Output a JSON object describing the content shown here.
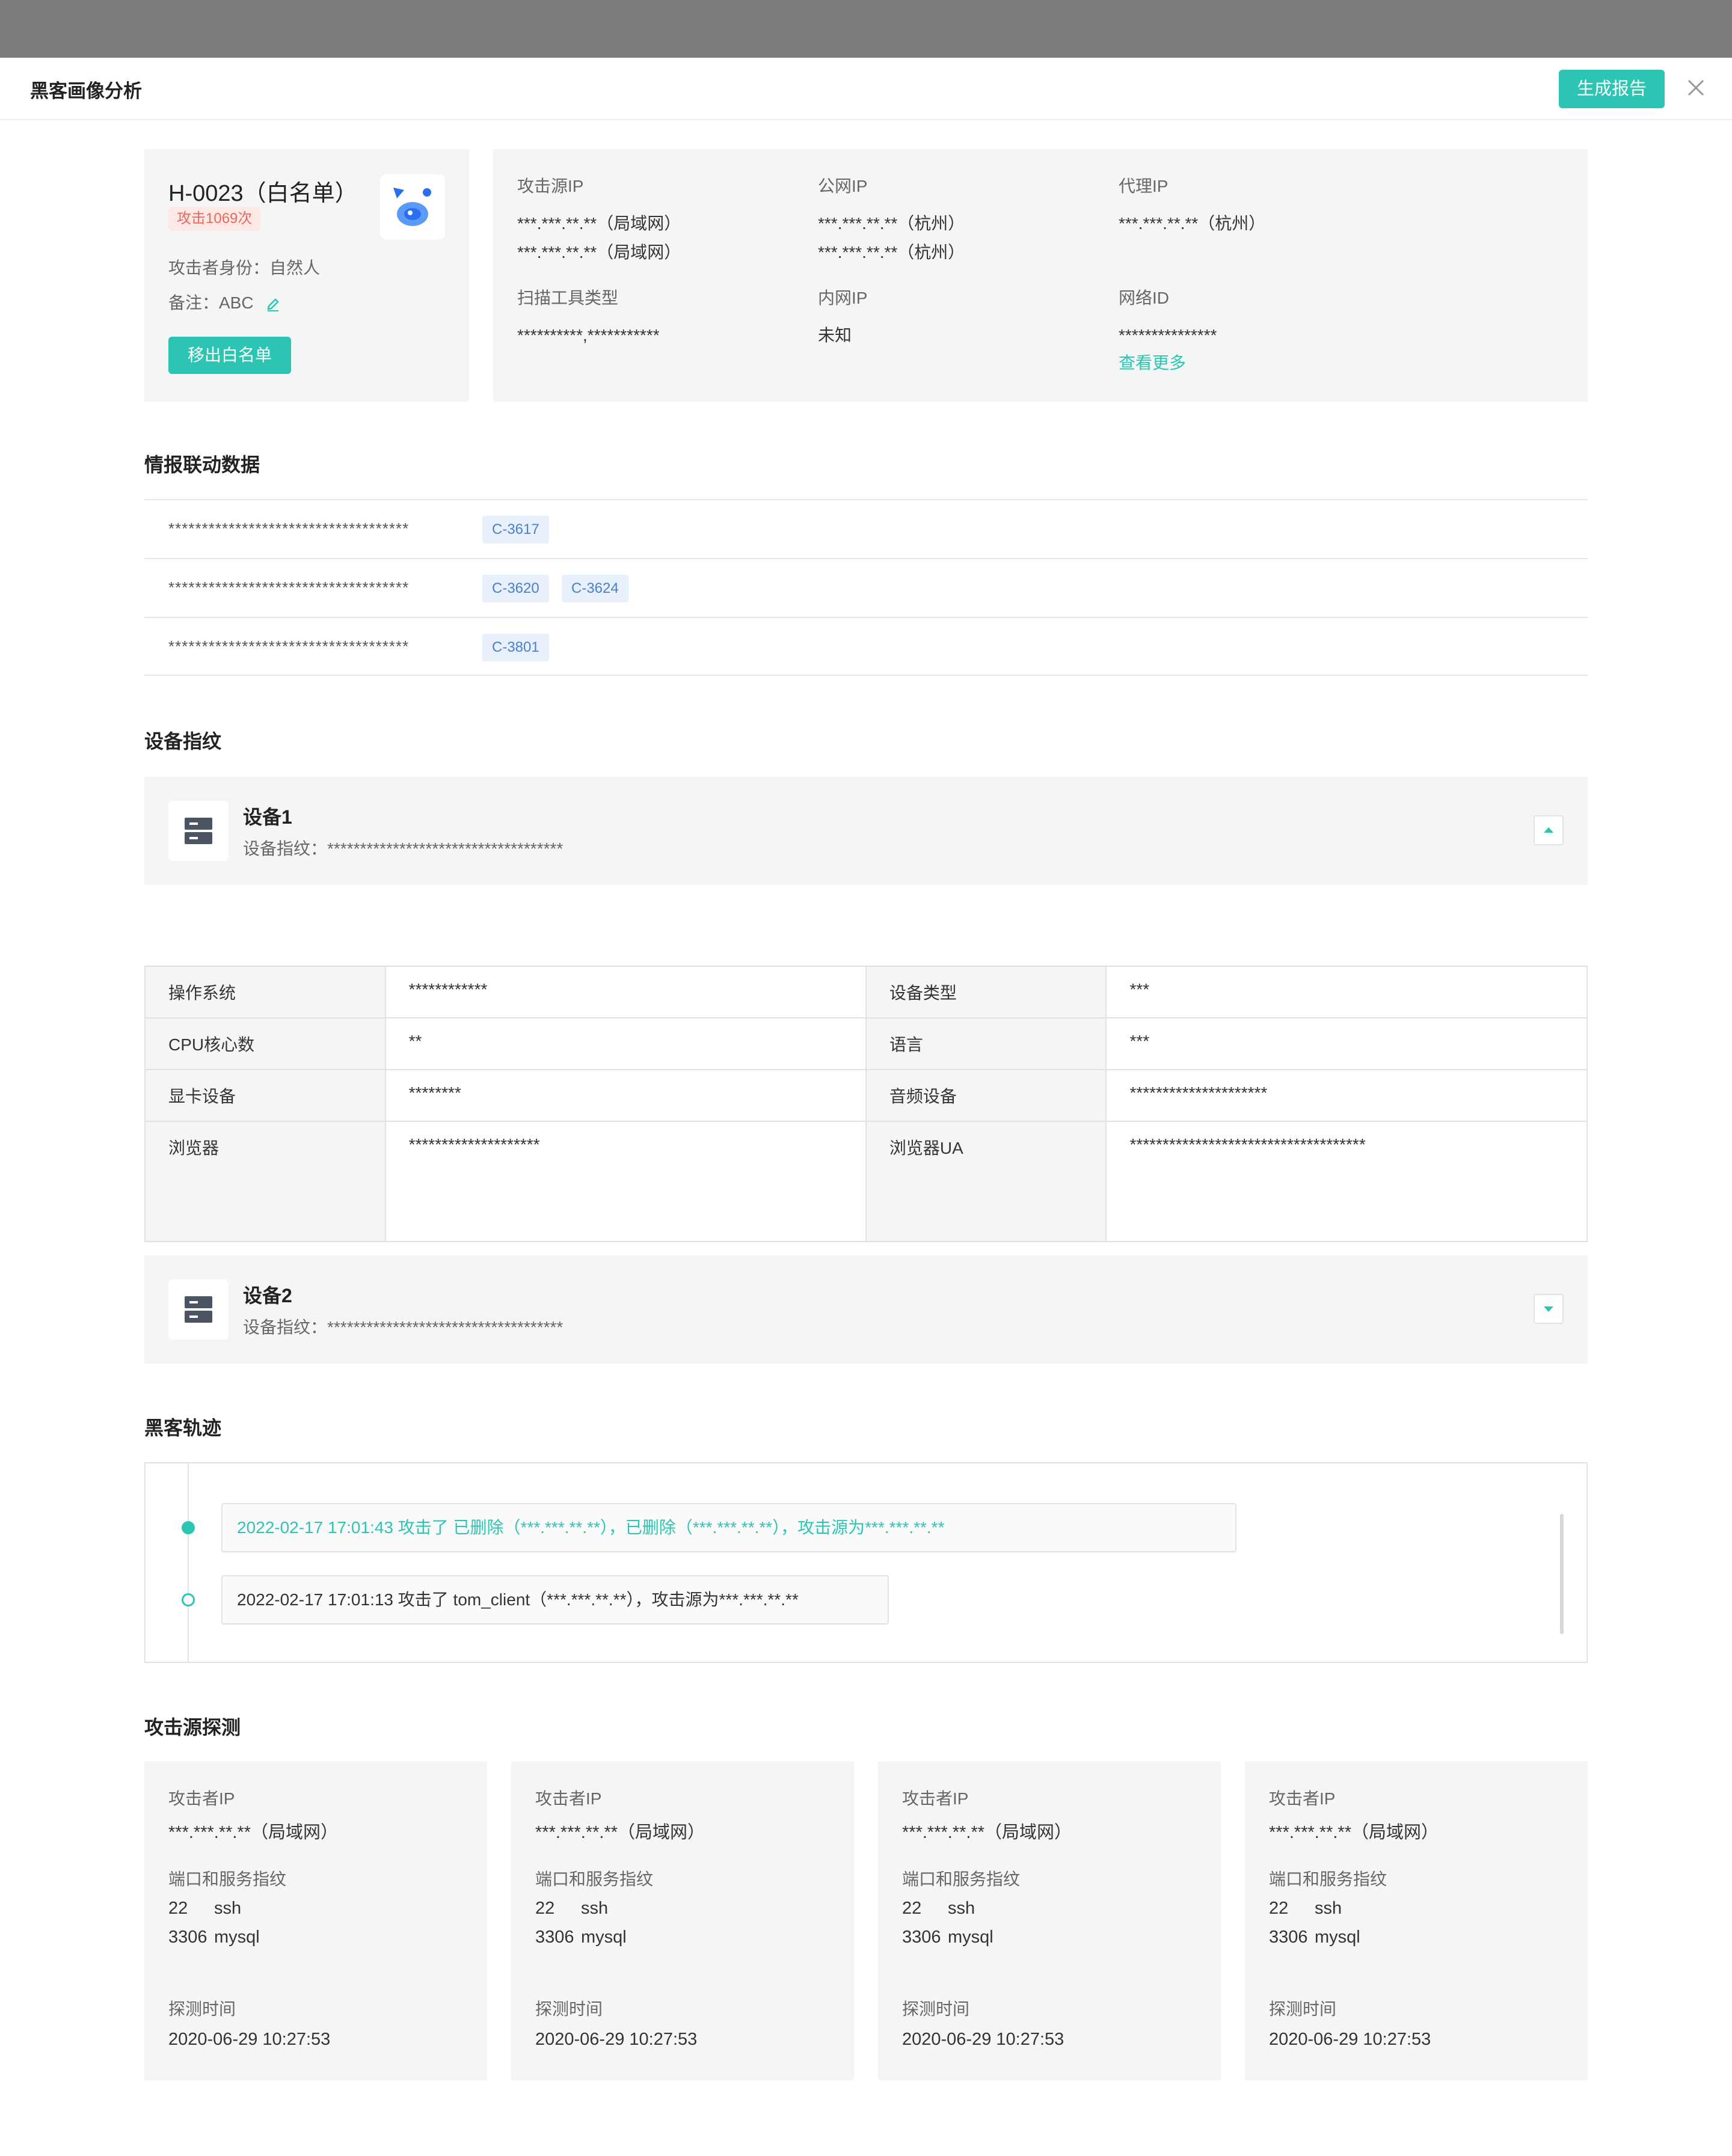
{
  "modal": {
    "title": "黑客画像分析",
    "report_button": "生成报告"
  },
  "profile": {
    "name": "H-0023（白名单）",
    "attack_badge": "攻击1069次",
    "identity": "攻击者身份：自然人",
    "remark": "备注：ABC",
    "remove_button": "移出白名单"
  },
  "info": {
    "source_ip_label": "攻击源IP",
    "source_ips": [
      "***.***.**.**（局域网）",
      "***.***.**.**（局域网）"
    ],
    "public_ip_label": "公网IP",
    "public_ips": [
      "***.***.**.**（杭州）",
      "***.***.**.**（杭州）"
    ],
    "proxy_ip_label": "代理IP",
    "proxy_ips": [
      "***.***.**.**（杭州）"
    ],
    "scan_tool_label": "扫描工具类型",
    "scan_tool": "**********,***********",
    "intranet_ip_label": "内网IP",
    "intranet_ip": "未知",
    "network_id_label": "网络ID",
    "network_id": "***************",
    "more_link": "查看更多"
  },
  "intel": {
    "title": "情报联动数据",
    "rows": [
      {
        "mask": "************************************",
        "tags": [
          "C-3617"
        ]
      },
      {
        "mask": "************************************",
        "tags": [
          "C-3620",
          "C-3624"
        ]
      },
      {
        "mask": "************************************",
        "tags": [
          "C-3801"
        ]
      }
    ]
  },
  "devices": {
    "title": "设备指纹",
    "list": [
      {
        "name": "设备1",
        "fingerprint": "设备指纹：************************************",
        "expanded": true
      },
      {
        "name": "设备2",
        "fingerprint": "设备指纹：************************************",
        "expanded": false
      }
    ],
    "table": {
      "os_label": "操作系统",
      "os": "************",
      "type_label": "设备类型",
      "type": "***",
      "cpu_label": "CPU核心数",
      "cpu": "**",
      "lang_label": "语言",
      "lang": "***",
      "gpu_label": "显卡设备",
      "gpu": "********",
      "audio_label": "音频设备",
      "audio": "*********************",
      "browser_label": "浏览器",
      "browser": "********************",
      "ua_label": "浏览器UA",
      "ua": "************************************"
    }
  },
  "track": {
    "title": "黑客轨迹",
    "events": [
      {
        "text": "2022-02-17 17:01:43 攻击了 已删除（***.***.**.**），已删除（***.***.**.**），攻击源为***.***.**.**",
        "active": true
      },
      {
        "text": "2022-02-17 17:01:13 攻击了 tom_client（***.***.**.**），攻击源为***.***.**.**",
        "active": false
      }
    ]
  },
  "scan": {
    "title": "攻击源探测",
    "cards": [
      {
        "ip_label": "攻击者IP",
        "ip": "***.***.**.**（局域网）",
        "ports_label": "端口和服务指纹",
        "ports": [
          {
            "port": "22",
            "service": "ssh"
          },
          {
            "port": "3306",
            "service": "mysql"
          }
        ],
        "time_label": "探测时间",
        "time": "2020-06-29 10:27:53"
      },
      {
        "ip_label": "攻击者IP",
        "ip": "***.***.**.**（局域网）",
        "ports_label": "端口和服务指纹",
        "ports": [
          {
            "port": "22",
            "service": "ssh"
          },
          {
            "port": "3306",
            "service": "mysql"
          }
        ],
        "time_label": "探测时间",
        "time": "2020-06-29 10:27:53"
      },
      {
        "ip_label": "攻击者IP",
        "ip": "***.***.**.**（局域网）",
        "ports_label": "端口和服务指纹",
        "ports": [
          {
            "port": "22",
            "service": "ssh"
          },
          {
            "port": "3306",
            "service": "mysql"
          }
        ],
        "time_label": "探测时间",
        "time": "2020-06-29 10:27:53"
      },
      {
        "ip_label": "攻击者IP",
        "ip": "***.***.**.**（局域网）",
        "ports_label": "端口和服务指纹",
        "ports": [
          {
            "port": "22",
            "service": "ssh"
          },
          {
            "port": "3306",
            "service": "mysql"
          }
        ],
        "time_label": "探测时间",
        "time": "2020-06-29 10:27:53"
      }
    ]
  },
  "colors": {
    "accent": "#2cc5b3",
    "danger": "#e8685a",
    "tag_blue": "#4a7fd0",
    "panel": "#f4f6f5"
  }
}
